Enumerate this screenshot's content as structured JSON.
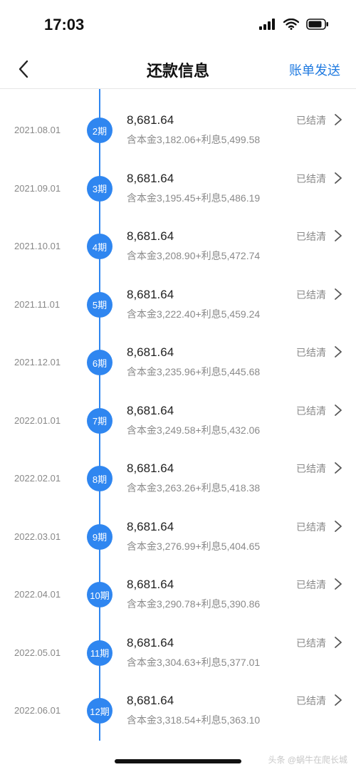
{
  "status_bar": {
    "time": "17:03"
  },
  "nav": {
    "title": "还款信息",
    "action": "账单发送"
  },
  "rows": [
    {
      "date": "2021.08.01",
      "period": "2期",
      "amount": "8,681.64",
      "detail": "含本金3,182.06+利息5,499.58",
      "status": "已结清"
    },
    {
      "date": "2021.09.01",
      "period": "3期",
      "amount": "8,681.64",
      "detail": "含本金3,195.45+利息5,486.19",
      "status": "已结清"
    },
    {
      "date": "2021.10.01",
      "period": "4期",
      "amount": "8,681.64",
      "detail": "含本金3,208.90+利息5,472.74",
      "status": "已结清"
    },
    {
      "date": "2021.11.01",
      "period": "5期",
      "amount": "8,681.64",
      "detail": "含本金3,222.40+利息5,459.24",
      "status": "已结清"
    },
    {
      "date": "2021.12.01",
      "period": "6期",
      "amount": "8,681.64",
      "detail": "含本金3,235.96+利息5,445.68",
      "status": "已结清"
    },
    {
      "date": "2022.01.01",
      "period": "7期",
      "amount": "8,681.64",
      "detail": "含本金3,249.58+利息5,432.06",
      "status": "已结清"
    },
    {
      "date": "2022.02.01",
      "period": "8期",
      "amount": "8,681.64",
      "detail": "含本金3,263.26+利息5,418.38",
      "status": "已结清"
    },
    {
      "date": "2022.03.01",
      "period": "9期",
      "amount": "8,681.64",
      "detail": "含本金3,276.99+利息5,404.65",
      "status": "已结清"
    },
    {
      "date": "2022.04.01",
      "period": "10期",
      "amount": "8,681.64",
      "detail": "含本金3,290.78+利息5,390.86",
      "status": "已结清"
    },
    {
      "date": "2022.05.01",
      "period": "11期",
      "amount": "8,681.64",
      "detail": "含本金3,304.63+利息5,377.01",
      "status": "已结清"
    },
    {
      "date": "2022.06.01",
      "period": "12期",
      "amount": "8,681.64",
      "detail": "含本金3,318.54+利息5,363.10",
      "status": "已结清"
    }
  ],
  "watermark": "头条 @蜗牛在爬长城",
  "colors": {
    "accent": "#2f86f0",
    "link": "#1f7ae0",
    "muted": "#888888"
  }
}
